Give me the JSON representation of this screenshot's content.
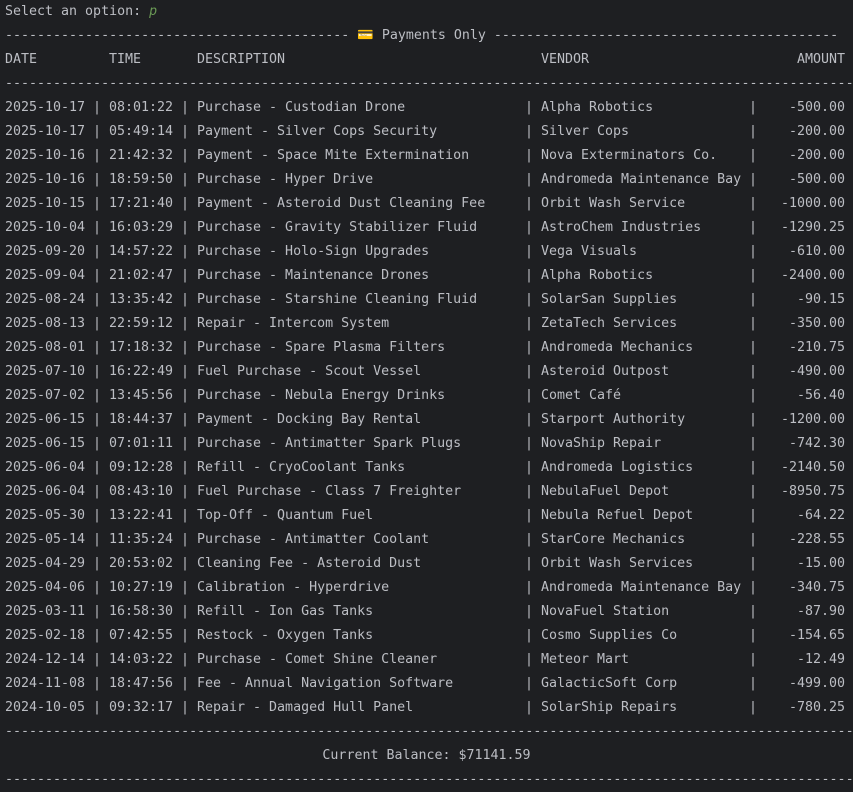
{
  "prompt": {
    "label": "Select an option:",
    "input": "p"
  },
  "banner": {
    "left_rule": "-------------------------------------------",
    "icon": "credit-card-icon",
    "icon_glyph": "💳",
    "title": "Payments Only",
    "right_rule": "-------------------------------------------"
  },
  "headers": {
    "date": "DATE",
    "time": "TIME",
    "description": "DESCRIPTION",
    "vendor": "VENDOR",
    "amount": "AMOUNT"
  },
  "rule": "------------------------------------------------------------------------------------------------------------",
  "pipe": "|",
  "rows": [
    {
      "date": "2025-10-17",
      "time": "08:01:22",
      "description": "Purchase - Custodian Drone",
      "vendor": "Alpha Robotics",
      "amount": "-500.00"
    },
    {
      "date": "2025-10-17",
      "time": "05:49:14",
      "description": "Payment - Silver Cops Security",
      "vendor": "Silver Cops",
      "amount": "-200.00"
    },
    {
      "date": "2025-10-16",
      "time": "21:42:32",
      "description": "Payment - Space Mite Extermination",
      "vendor": "Nova Exterminators Co.",
      "amount": "-200.00"
    },
    {
      "date": "2025-10-16",
      "time": "18:59:50",
      "description": "Purchase - Hyper Drive",
      "vendor": "Andromeda Maintenance Bay",
      "amount": "-500.00"
    },
    {
      "date": "2025-10-15",
      "time": "17:21:40",
      "description": "Payment - Asteroid Dust Cleaning Fee",
      "vendor": "Orbit Wash Service",
      "amount": "-1000.00"
    },
    {
      "date": "2025-10-04",
      "time": "16:03:29",
      "description": "Purchase - Gravity Stabilizer Fluid",
      "vendor": "AstroChem Industries",
      "amount": "-1290.25"
    },
    {
      "date": "2025-09-20",
      "time": "14:57:22",
      "description": "Purchase - Holo-Sign Upgrades",
      "vendor": "Vega Visuals",
      "amount": "-610.00"
    },
    {
      "date": "2025-09-04",
      "time": "21:02:47",
      "description": "Purchase - Maintenance Drones",
      "vendor": "Alpha Robotics",
      "amount": "-2400.00"
    },
    {
      "date": "2025-08-24",
      "time": "13:35:42",
      "description": "Purchase - Starshine Cleaning Fluid",
      "vendor": "SolarSan Supplies",
      "amount": "-90.15"
    },
    {
      "date": "2025-08-13",
      "time": "22:59:12",
      "description": "Repair - Intercom System",
      "vendor": "ZetaTech Services",
      "amount": "-350.00"
    },
    {
      "date": "2025-08-01",
      "time": "17:18:32",
      "description": "Purchase - Spare Plasma Filters",
      "vendor": "Andromeda Mechanics",
      "amount": "-210.75"
    },
    {
      "date": "2025-07-10",
      "time": "16:22:49",
      "description": "Fuel Purchase - Scout Vessel",
      "vendor": "Asteroid Outpost",
      "amount": "-490.00"
    },
    {
      "date": "2025-07-02",
      "time": "13:45:56",
      "description": "Purchase - Nebula Energy Drinks",
      "vendor": "Comet Café",
      "amount": "-56.40"
    },
    {
      "date": "2025-06-15",
      "time": "18:44:37",
      "description": "Payment - Docking Bay Rental",
      "vendor": "Starport Authority",
      "amount": "-1200.00"
    },
    {
      "date": "2025-06-15",
      "time": "07:01:11",
      "description": "Purchase - Antimatter Spark Plugs",
      "vendor": "NovaShip Repair",
      "amount": "-742.30"
    },
    {
      "date": "2025-06-04",
      "time": "09:12:28",
      "description": "Refill - CryoCoolant Tanks",
      "vendor": "Andromeda Logistics",
      "amount": "-2140.50"
    },
    {
      "date": "2025-06-04",
      "time": "08:43:10",
      "description": "Fuel Purchase - Class 7 Freighter",
      "vendor": "NebulaFuel Depot",
      "amount": "-8950.75"
    },
    {
      "date": "2025-05-30",
      "time": "13:22:41",
      "description": "Top-Off - Quantum Fuel",
      "vendor": "Nebula Refuel Depot",
      "amount": "-64.22"
    },
    {
      "date": "2025-05-14",
      "time": "11:35:24",
      "description": "Purchase - Antimatter Coolant",
      "vendor": "StarCore Mechanics",
      "amount": "-228.55"
    },
    {
      "date": "2025-04-29",
      "time": "20:53:02",
      "description": "Cleaning Fee - Asteroid Dust",
      "vendor": "Orbit Wash Services",
      "amount": "-15.00"
    },
    {
      "date": "2025-04-06",
      "time": "10:27:19",
      "description": "Calibration - Hyperdrive",
      "vendor": "Andromeda Maintenance Bay",
      "amount": "-340.75"
    },
    {
      "date": "2025-03-11",
      "time": "16:58:30",
      "description": "Refill - Ion Gas Tanks",
      "vendor": "NovaFuel Station",
      "amount": "-87.90"
    },
    {
      "date": "2025-02-18",
      "time": "07:42:55",
      "description": "Restock - Oxygen Tanks",
      "vendor": "Cosmo Supplies Co",
      "amount": "-154.65"
    },
    {
      "date": "2024-12-14",
      "time": "14:03:22",
      "description": "Purchase - Comet Shine Cleaner",
      "vendor": "Meteor Mart",
      "amount": "-12.49"
    },
    {
      "date": "2024-11-08",
      "time": "18:47:56",
      "description": "Fee - Annual Navigation Software",
      "vendor": "GalacticSoft Corp",
      "amount": "-499.00"
    },
    {
      "date": "2024-10-05",
      "time": "09:32:17",
      "description": "Repair - Damaged Hull Panel",
      "vendor": "SolarShip Repairs",
      "amount": "-780.25"
    }
  ],
  "balance": "Current Balance: $71141.59",
  "colors": {
    "background": "#1e1f22",
    "text": "#bcbec4",
    "input": "#6a9955",
    "icon": "#4ea5d9"
  }
}
